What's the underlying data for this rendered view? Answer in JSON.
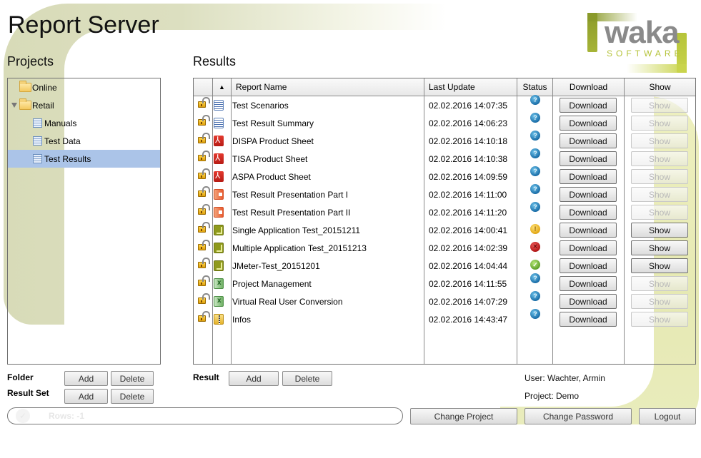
{
  "app": {
    "title": "Report Server"
  },
  "logo": {
    "name": "waka",
    "tagline": "SOFTWARE"
  },
  "colors": {
    "accent_green": "#b5c33a",
    "logo_gray": "#8a8a8a",
    "selection": "#abc4e8"
  },
  "projects": {
    "heading": "Projects",
    "tree": [
      {
        "label": "Online",
        "icon": "folder-icon",
        "level": 0,
        "expanded": false
      },
      {
        "label": "Retail",
        "icon": "folder-icon",
        "level": 0,
        "expanded": true
      },
      {
        "label": "Manuals",
        "icon": "table-icon",
        "level": 1
      },
      {
        "label": "Test Data",
        "icon": "table-icon",
        "level": 1
      },
      {
        "label": "Test Results",
        "icon": "table-icon",
        "level": 1,
        "selected": true
      }
    ],
    "folder_label": "Folder",
    "result_set_label": "Result Set",
    "add_label": "Add",
    "delete_label": "Delete"
  },
  "results": {
    "heading": "Results",
    "sort_indicator": "▲",
    "columns": [
      "Report Name",
      "Last Update",
      "Status",
      "Download",
      "Show"
    ],
    "download_label": "Download",
    "show_label": "Show",
    "rows": [
      {
        "name": "Test Scenarios",
        "type": "word",
        "updated": "02.02.2016 14:07:35",
        "status": "info",
        "show_enabled": false
      },
      {
        "name": "Test Result Summary",
        "type": "word",
        "updated": "02.02.2016 14:06:23",
        "status": "info",
        "show_enabled": false
      },
      {
        "name": "DISPA Product Sheet",
        "type": "pdf",
        "updated": "02.02.2016 14:10:18",
        "status": "info",
        "show_enabled": false
      },
      {
        "name": "TISA Product Sheet",
        "type": "pdf",
        "updated": "02.02.2016 14:10:38",
        "status": "info",
        "show_enabled": false
      },
      {
        "name": "ASPA Product Sheet",
        "type": "pdf",
        "updated": "02.02.2016 14:09:59",
        "status": "info",
        "show_enabled": false
      },
      {
        "name": "Test Result Presentation Part I",
        "type": "ppt",
        "updated": "02.02.2016 14:11:00",
        "status": "info",
        "show_enabled": false
      },
      {
        "name": "Test Result Presentation Part II",
        "type": "ppt",
        "updated": "02.02.2016 14:11:20",
        "status": "info",
        "show_enabled": false
      },
      {
        "name": "Single Application Test_20151211",
        "type": "jm",
        "updated": "02.02.2016 14:00:41",
        "status": "warning",
        "show_enabled": true
      },
      {
        "name": "Multiple Application Test_20151213",
        "type": "jm",
        "updated": "02.02.2016 14:02:39",
        "status": "error",
        "show_enabled": true
      },
      {
        "name": "JMeter-Test_20151201",
        "type": "jm",
        "updated": "02.02.2016 14:04:44",
        "status": "ok",
        "show_enabled": true
      },
      {
        "name": "Project Management",
        "type": "xls",
        "updated": "02.02.2016 14:11:55",
        "status": "info",
        "show_enabled": false
      },
      {
        "name": "Virtual Real User Conversion",
        "type": "xls",
        "updated": "02.02.2016 14:07:29",
        "status": "info",
        "show_enabled": false
      },
      {
        "name": "Infos",
        "type": "zip",
        "updated": "02.02.2016 14:43:47",
        "status": "info",
        "show_enabled": false
      }
    ],
    "result_label": "Result",
    "add_label": "Add",
    "delete_label": "Delete"
  },
  "session": {
    "user": "User: Wachter, Armin",
    "project": "Project: Demo"
  },
  "statusbar": {
    "text": "Rows: -1"
  },
  "footer": {
    "change_project": "Change Project",
    "change_password": "Change Password",
    "logout": "Logout"
  }
}
